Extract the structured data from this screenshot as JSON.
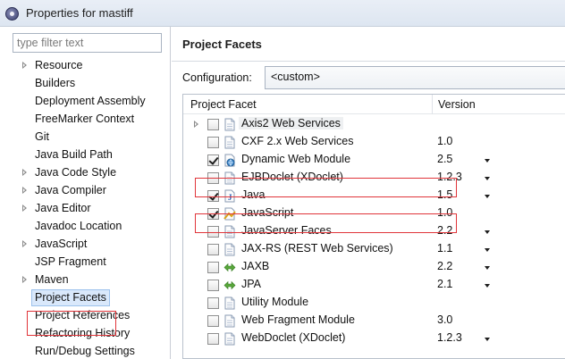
{
  "window": {
    "title": "Properties for mastiff",
    "icon": "eclipse-app-icon"
  },
  "sidebar": {
    "filter_placeholder": "type filter text",
    "items": [
      {
        "label": "Resource",
        "expandable": true
      },
      {
        "label": "Builders",
        "expandable": false
      },
      {
        "label": "Deployment Assembly",
        "expandable": false
      },
      {
        "label": "FreeMarker Context",
        "expandable": false
      },
      {
        "label": "Git",
        "expandable": false
      },
      {
        "label": "Java Build Path",
        "expandable": false
      },
      {
        "label": "Java Code Style",
        "expandable": true
      },
      {
        "label": "Java Compiler",
        "expandable": true
      },
      {
        "label": "Java Editor",
        "expandable": true
      },
      {
        "label": "Javadoc Location",
        "expandable": false
      },
      {
        "label": "JavaScript",
        "expandable": true
      },
      {
        "label": "JSP Fragment",
        "expandable": false
      },
      {
        "label": "Maven",
        "expandable": true
      },
      {
        "label": "Project Facets",
        "expandable": false,
        "selected": true
      },
      {
        "label": "Project References",
        "expandable": false
      },
      {
        "label": "Refactoring History",
        "expandable": false
      },
      {
        "label": "Run/Debug Settings",
        "expandable": false
      }
    ]
  },
  "main": {
    "title": "Project Facets",
    "configuration_label": "Configuration:",
    "configuration_value": "<custom>",
    "table": {
      "col_facet": "Project Facet",
      "col_version": "Version",
      "rows": [
        {
          "name": "Axis2 Web Services",
          "version": "",
          "checked": false,
          "expandable": true,
          "dropdown": false,
          "icon": "page-icon"
        },
        {
          "name": "CXF 2.x Web Services",
          "version": "1.0",
          "checked": false,
          "expandable": false,
          "dropdown": false,
          "icon": "page-icon"
        },
        {
          "name": "Dynamic Web Module",
          "version": "2.5",
          "checked": true,
          "expandable": false,
          "dropdown": true,
          "icon": "web-module-icon"
        },
        {
          "name": "EJBDoclet (XDoclet)",
          "version": "1.2.3",
          "checked": false,
          "expandable": false,
          "dropdown": true,
          "icon": "page-icon"
        },
        {
          "name": "Java",
          "version": "1.5",
          "checked": true,
          "expandable": false,
          "dropdown": true,
          "icon": "java-file-icon"
        },
        {
          "name": "JavaScript",
          "version": "1.0",
          "checked": true,
          "expandable": false,
          "dropdown": false,
          "icon": "javascript-icon"
        },
        {
          "name": "JavaServer Faces",
          "version": "2.2",
          "checked": false,
          "expandable": false,
          "dropdown": true,
          "icon": "page-icon"
        },
        {
          "name": "JAX-RS (REST Web Services)",
          "version": "1.1",
          "checked": false,
          "expandable": false,
          "dropdown": true,
          "icon": "page-icon"
        },
        {
          "name": "JAXB",
          "version": "2.2",
          "checked": false,
          "expandable": false,
          "dropdown": true,
          "icon": "jaxb-icon"
        },
        {
          "name": "JPA",
          "version": "2.1",
          "checked": false,
          "expandable": false,
          "dropdown": true,
          "icon": "jpa-icon"
        },
        {
          "name": "Utility Module",
          "version": "",
          "checked": false,
          "expandable": false,
          "dropdown": false,
          "icon": "page-icon"
        },
        {
          "name": "Web Fragment Module",
          "version": "3.0",
          "checked": false,
          "expandable": false,
          "dropdown": false,
          "icon": "page-icon"
        },
        {
          "name": "WebDoclet (XDoclet)",
          "version": "1.2.3",
          "checked": false,
          "expandable": false,
          "dropdown": true,
          "icon": "page-icon"
        }
      ]
    }
  },
  "colors": {
    "highlight_box": "#e0353a",
    "selection_bg": "#d9e8fb"
  }
}
